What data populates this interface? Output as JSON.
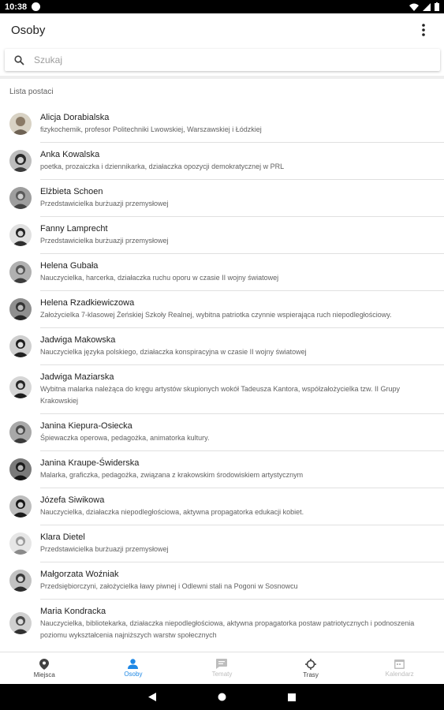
{
  "status_bar": {
    "time": "10:38"
  },
  "app_bar": {
    "title": "Osoby"
  },
  "search": {
    "placeholder": "Szukaj"
  },
  "list": {
    "header": "Lista postaci",
    "items": [
      {
        "name": "Alicja Dorabialska",
        "desc": "fizykochemik, profesor Politechniki Lwowskiej, Warszawskiej i Łódzkiej"
      },
      {
        "name": "Anka Kowalska",
        "desc": "poetka, prozaiczka i dziennikarka, działaczka opozycji demokratycznej w PRL"
      },
      {
        "name": "Elżbieta Schoen",
        "desc": "Przedstawicielka burżuazji przemysłowej"
      },
      {
        "name": "Fanny Lamprecht",
        "desc": "Przedstawicielka burżuazji przemysłowej"
      },
      {
        "name": "Helena Gubała",
        "desc": "Nauczycielka, harcerka, działaczka ruchu oporu w czasie II wojny światowej"
      },
      {
        "name": "Helena Rzadkiewiczowa",
        "desc": "Założycielka 7-klasowej Żeńskiej Szkoły Realnej, wybitna patriotka czynnie wspierająca ruch niepodległościowy."
      },
      {
        "name": "Jadwiga Makowska",
        "desc": "Nauczycielka języka polskiego, działaczka  konspiracyjna w czasie II wojny światowej"
      },
      {
        "name": "Jadwiga Maziarska",
        "desc": "Wybitna malarka należąca do kręgu artystów skupionych wokół Tadeusza Kantora, współzałożycielka tzw. II Grupy Krakowskiej"
      },
      {
        "name": "Janina Kiepura-Osiecka",
        "desc": "Śpiewaczka operowa, pedagożka, animatorka kultury."
      },
      {
        "name": "Janina Kraupe-Świderska",
        "desc": "Malarka, graficzka, pedagożka, związana z krakowskim środowiskiem artystycznym"
      },
      {
        "name": "Józefa Siwikowa",
        "desc": "Nauczycielka, działaczka niepodległościowa, aktywna propagatorka edukacji kobiet."
      },
      {
        "name": "Klara Dietel",
        "desc": "Przedstawicielka burżuazji przemysłowej"
      },
      {
        "name": "Małgorzata Woźniak",
        "desc": "Przedsiębiorczyni, założycielka ławy piwnej i Odlewni stali na Pogoni w Sosnowcu"
      },
      {
        "name": "Maria Kondracka",
        "desc": "Nauczycielka, bibliotekarka, działaczka niepodległościowa, aktywna propagatorka postaw patriotycznych i podnoszenia poziomu wykształcenia najniższych warstw społecznych"
      }
    ]
  },
  "bottom_nav": {
    "items": [
      {
        "label": "Miejsca",
        "icon": "place-pin-icon",
        "state": "normal"
      },
      {
        "label": "Osoby",
        "icon": "person-icon",
        "state": "active"
      },
      {
        "label": "Tematy",
        "icon": "chat-bubble-icon",
        "state": "disabled"
      },
      {
        "label": "Trasy",
        "icon": "route-icon",
        "state": "normal"
      },
      {
        "label": "Kalendarz",
        "icon": "calendar-icon",
        "state": "disabled"
      }
    ]
  },
  "colors": {
    "accent": "#1e88e5",
    "text_primary": "#212121",
    "text_secondary": "#616161",
    "disabled": "#bdbdbd"
  }
}
